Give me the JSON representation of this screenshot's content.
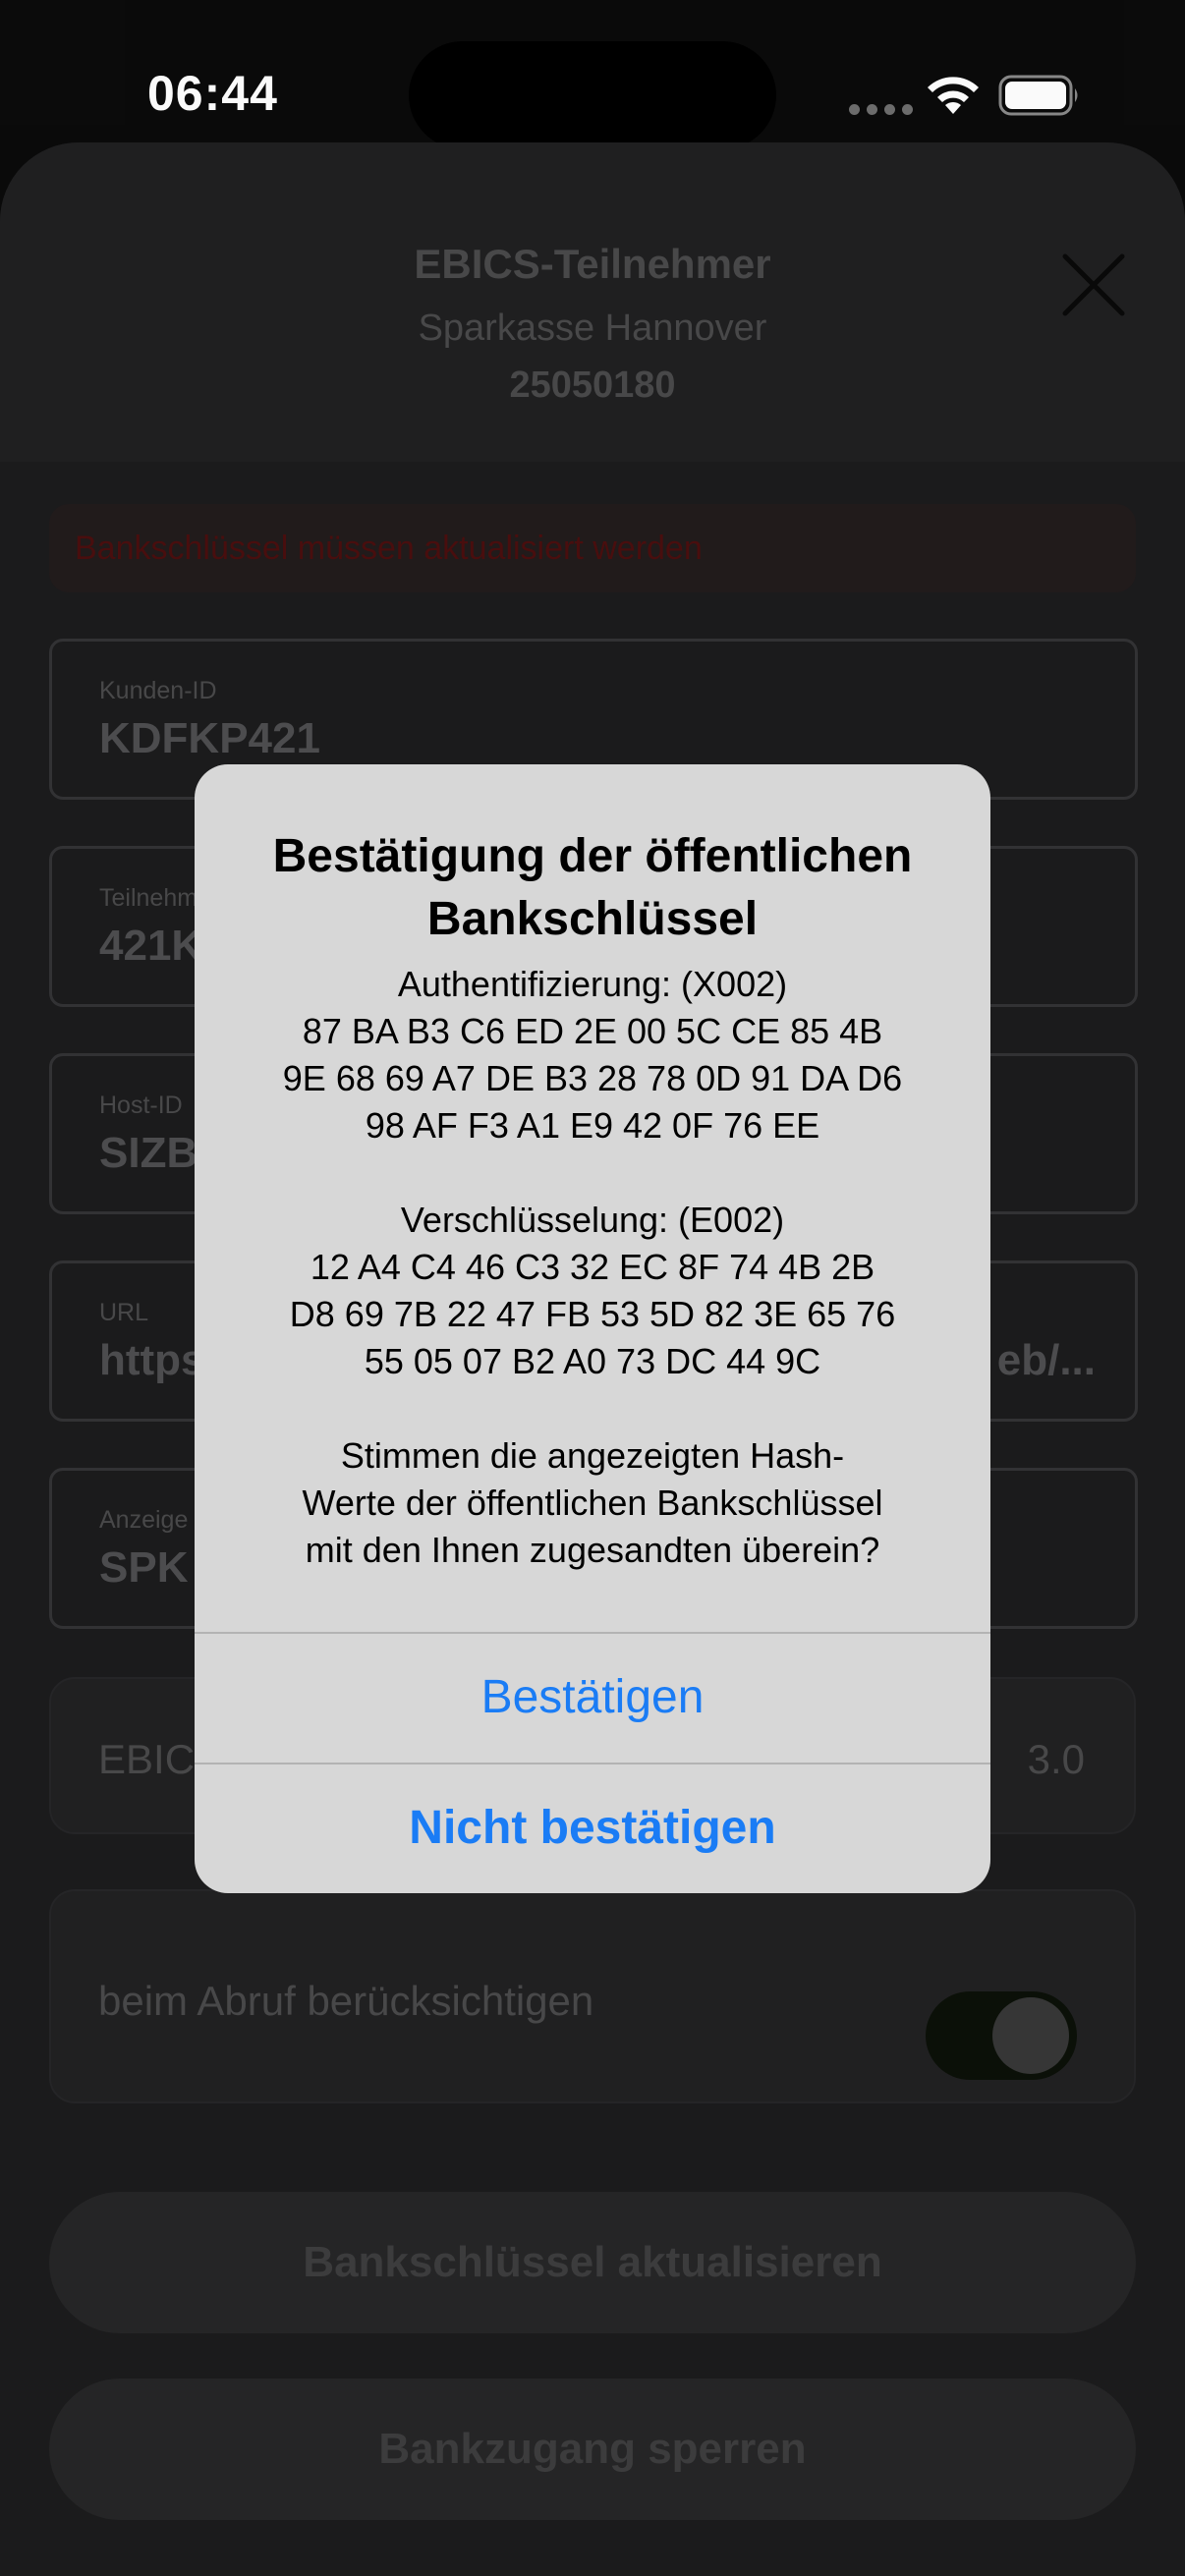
{
  "status_bar": {
    "time": "06:44"
  },
  "sheet": {
    "title": "EBICS-Teilnehmer",
    "subtitle": "Sparkasse Hannover",
    "blz": "25050180",
    "warning": "Bankschlüssel müssen aktualisiert werden",
    "fields": [
      {
        "label": "Kunden-ID",
        "value": "KDFKP421"
      },
      {
        "label": "Teilnehm",
        "value": "421K"
      },
      {
        "label": "Host-ID",
        "value": "SIZB"
      },
      {
        "label": "URL",
        "value": "https",
        "value_right": "eb/..."
      },
      {
        "label": "Anzeige",
        "value": "SPK"
      }
    ],
    "version_card": {
      "label": "EBIC",
      "value": "3.0"
    },
    "toggle_card": {
      "label": "beim Abruf berücksichtigen"
    },
    "buttons": {
      "update_keys": "Bankschlüssel aktualisieren",
      "block_access": "Bankzugang sperren"
    }
  },
  "alert": {
    "title": "Bestätigung der öffentlichen Bankschlüssel",
    "message": "Authentifizierung: (X002)\n87 BA B3 C6 ED 2E 00 5C CE 85 4B\n9E 68 69 A7 DE B3 28 78 0D 91 DA D6\n98 AF F3 A1 E9 42 0F 76 EE\n\nVerschlüsselung: (E002)\n12 A4 C4 46 C3 32 EC 8F 74 4B 2B\nD8 69 7B 22 47 FB 53 5D 82 3E 65 76\n55 05 07 B2 A0 73 DC 44 9C\n\nStimmen die angezeigten Hash-\nWerte der öffentlichen Bankschlüssel\nmit den Ihnen zugesandten überein?",
    "confirm_label": "Bestätigen",
    "reject_label": "Nicht bestätigen"
  },
  "colors": {
    "accent": "#1a7cf5",
    "alert_background": "#d7d7d7",
    "warning_text": "#4b0f0f"
  },
  "icons": {
    "close": "close-icon",
    "wifi": "wifi-icon",
    "battery": "battery-icon"
  }
}
